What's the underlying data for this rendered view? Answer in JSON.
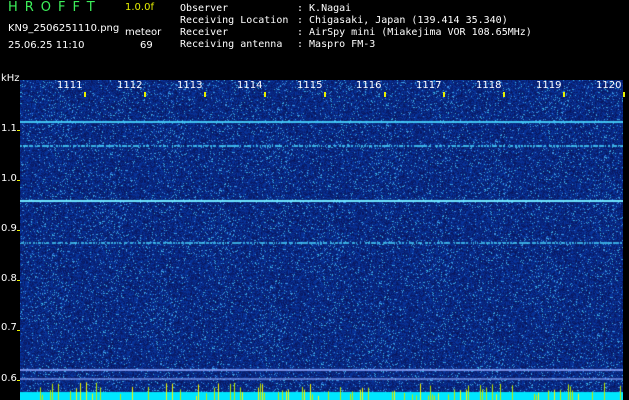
{
  "header": {
    "app_title": "HROFFT",
    "version": "1.0.0f",
    "filename": "KN9_2506251110.png",
    "datetime": "25.06.25 11:10",
    "meteor_label": "meteor",
    "meteor_count": "69",
    "info_labels": [
      "Observer",
      "Receiving Location",
      "Receiver",
      "Receiving antenna"
    ],
    "info_values": [
      ": K.Nagai",
      ": Chigasaki, Japan (139.414 35.340)",
      ": AirSpy mini (Miakejima VOR 108.65MHz)",
      ": Maspro FM-3"
    ]
  },
  "axis": {
    "unit": "kHz",
    "y_ticks": [
      "1.1",
      "1.0",
      "0.9",
      "0.8",
      "0.7",
      "0.6"
    ],
    "x_ticks": [
      "1111",
      "1112",
      "1113",
      "1114",
      "1115",
      "1116",
      "1117",
      "1118",
      "1119",
      "1120"
    ]
  },
  "colors": {
    "background": "#000000",
    "title_green": "#3df05a",
    "accent_yellow": "#e6f000",
    "noise_blue": "#0a1a6e",
    "signal_cyan": "#48d6ff",
    "bottom_bar": "#00e6ff"
  }
}
